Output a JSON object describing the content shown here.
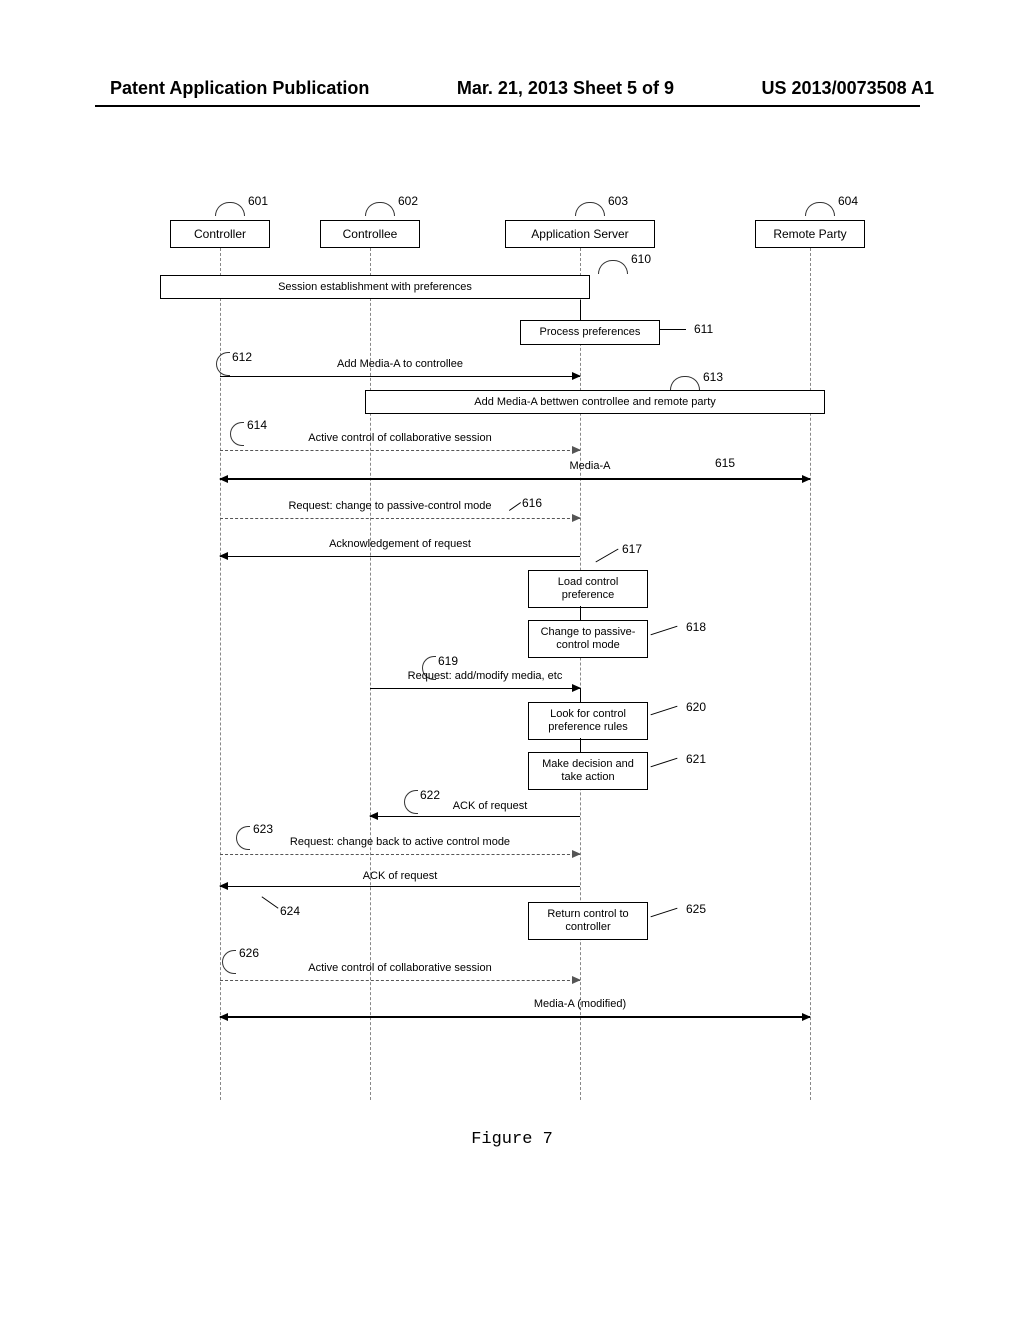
{
  "header": {
    "left": "Patent Application Publication",
    "center": "Mar. 21, 2013  Sheet 5 of 9",
    "right": "US 2013/0073508 A1"
  },
  "actors": {
    "a1": "Controller",
    "a2": "Controllee",
    "a3": "Application Server",
    "a4": "Remote Party"
  },
  "refs": {
    "r601": "601",
    "r602": "602",
    "r603": "603",
    "r604": "604",
    "r610": "610",
    "r611": "611",
    "r612": "612",
    "r613": "613",
    "r614": "614",
    "r615": "615",
    "r616": "616",
    "r617": "617",
    "r618": "618",
    "r619": "619",
    "r620": "620",
    "r621": "621",
    "r622": "622",
    "r623": "623",
    "r624": "624",
    "r625": "625",
    "r626": "626"
  },
  "boxes": {
    "b610": "Session establishment with preferences",
    "b611": "Process preferences",
    "b613": "Add Media-A bettwen controllee and remote party",
    "b617": "Load control preference",
    "b618": "Change to passive-control mode",
    "b620": "Look for control preference rules",
    "b621": "Make decision and take action",
    "b625": "Return control to controller"
  },
  "msgs": {
    "m612": "Add Media-A to controllee",
    "m614": "Active control of collaborative session",
    "m615": "Media-A",
    "m616": "Request: change to passive-control mode",
    "m616ack": "Acknowledgement of request",
    "m619": "Request: add/modify media, etc",
    "m622": "ACK of request",
    "m623": "Request: change back to active control mode",
    "m623ack": "ACK of request",
    "m626": "Active control of collaborative session",
    "m627": "Media-A (modified)"
  },
  "figure_caption": "Figure 7"
}
